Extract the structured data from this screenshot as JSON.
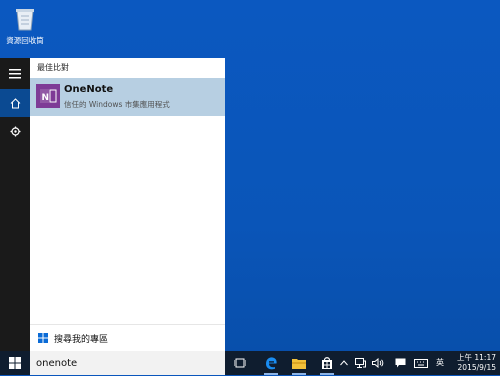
{
  "desktop": {
    "recycle_bin_label": "資源回收筒"
  },
  "start_panel": {
    "section_title": "最佳比對",
    "result": {
      "name": "OneNote",
      "subtitle": "信任的 Windows 市集應用程式",
      "icon": "onenote-icon"
    },
    "web_search_label": "搜尋我的專區"
  },
  "taskbar": {
    "search_value": "onenote",
    "ime_indicator": "英",
    "clock_time": "上午 11:17",
    "clock_date": "2015/9/15"
  }
}
